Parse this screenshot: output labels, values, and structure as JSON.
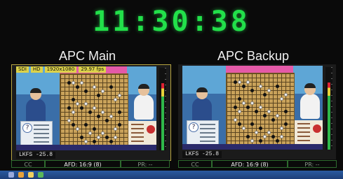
{
  "clock": {
    "time": "11:30:38",
    "color": "#22e04a"
  },
  "panels": {
    "main": {
      "title": "APC Main",
      "badges": [
        "SDI",
        "HD",
        "1920x1080",
        "29.97 fps"
      ],
      "lkfs": "LKFS -25.8",
      "status": {
        "cc": "CC",
        "afd": "AFD: 16:9 (8)",
        "pr": "PR: --"
      },
      "border_color": "#b8a640"
    },
    "backup": {
      "title": "APC Backup",
      "lkfs": "LKFS -25.8",
      "status": {
        "cc": "CC",
        "afd": "AFD: 16:9 (8)",
        "pr": "PR: --"
      }
    }
  },
  "icons": {
    "taskbar": [
      "start-icon",
      "browser-icon",
      "folder-icon",
      "media-icon"
    ],
    "meter": "audio-level-meter",
    "info": "question-icon"
  }
}
